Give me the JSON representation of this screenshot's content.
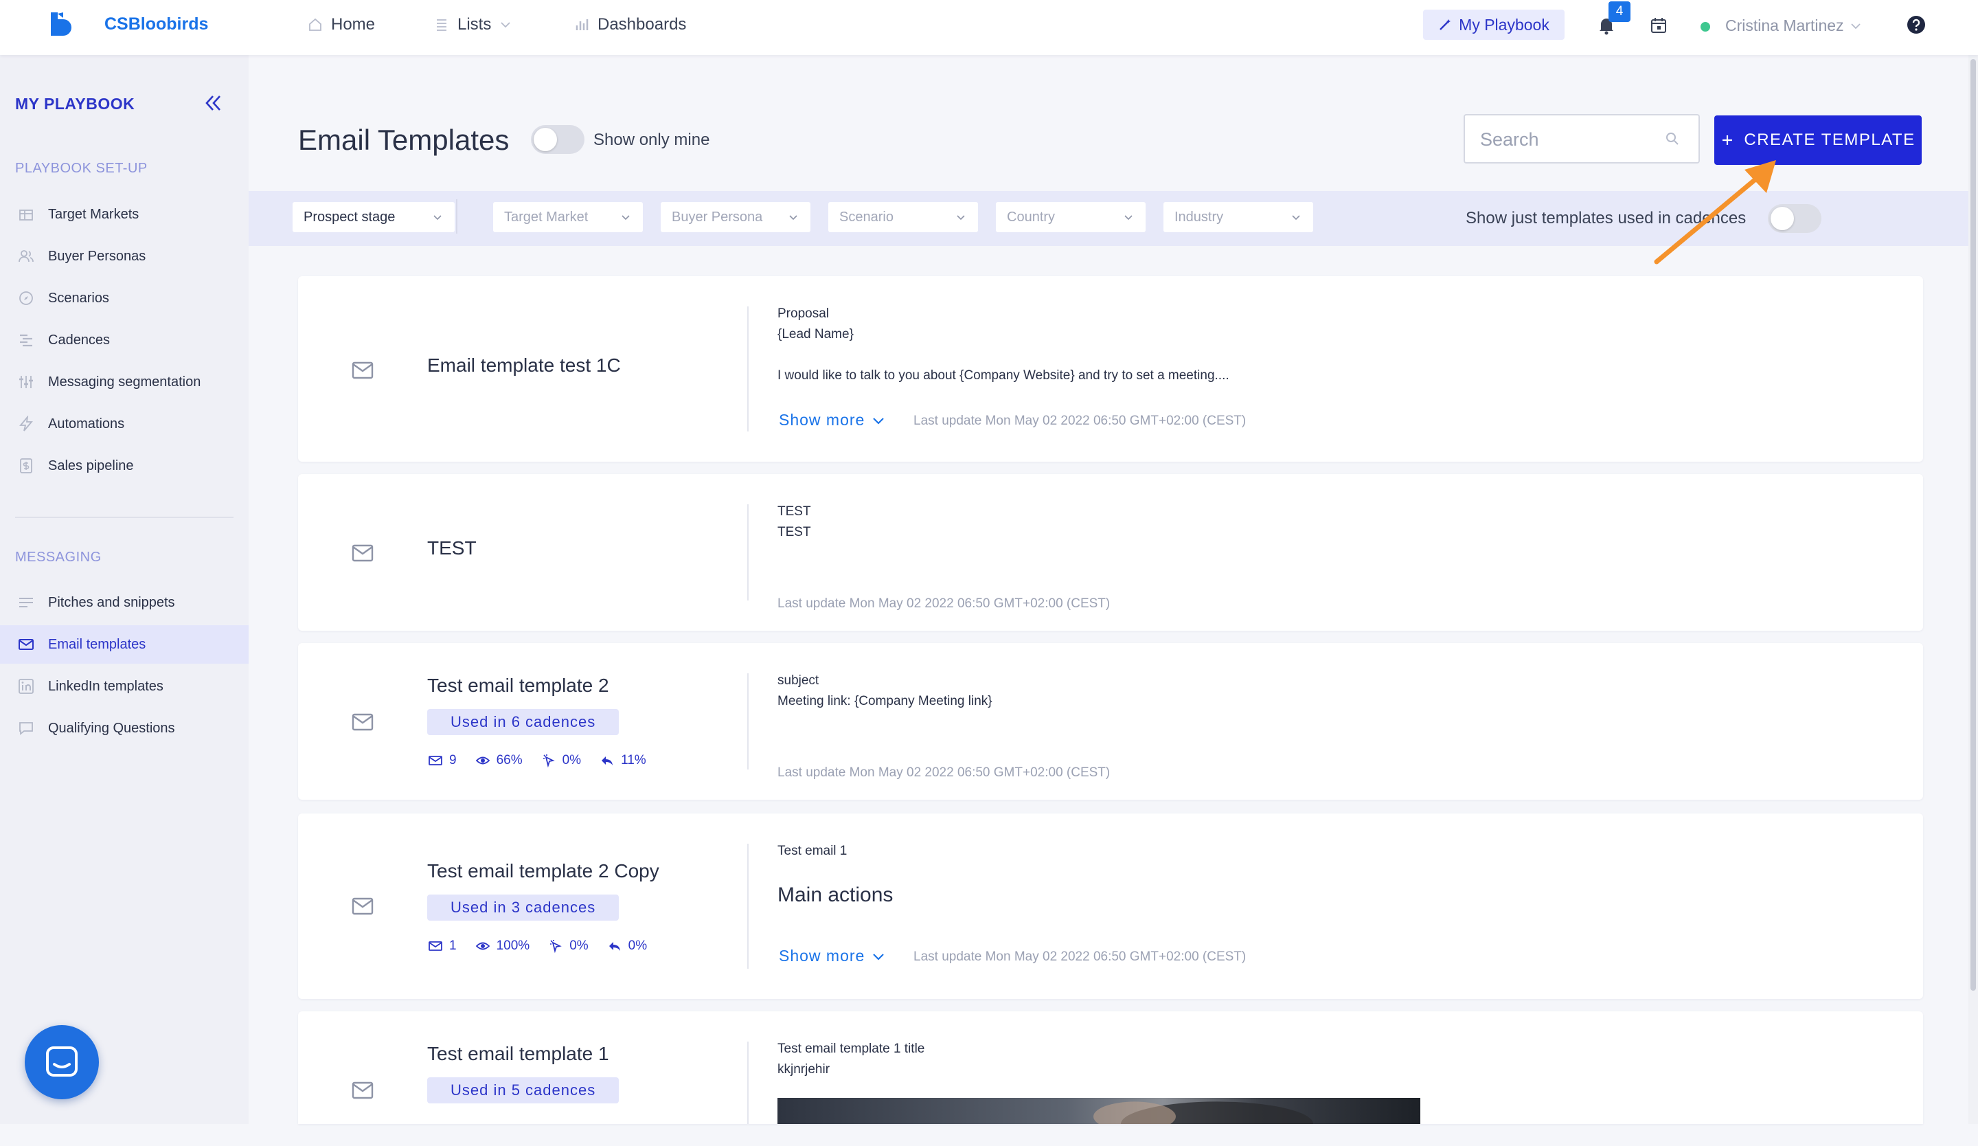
{
  "app": {
    "brand": "CSBloobirds",
    "nav": [
      {
        "label": "Home",
        "icon": "home-icon"
      },
      {
        "label": "Lists",
        "icon": "list-icon"
      },
      {
        "label": "Dashboards",
        "icon": "bar-chart-icon"
      }
    ],
    "playbook_button": "My Playbook",
    "notification_count": "4",
    "user_name": "Cristina Martinez",
    "user_status": "online"
  },
  "sidebar": {
    "title": "MY PLAYBOOK",
    "sections": [
      {
        "label": "PLAYBOOK SET-UP",
        "items": [
          {
            "label": "Target Markets",
            "icon": "target-markets-icon"
          },
          {
            "label": "Buyer Personas",
            "icon": "buyer-personas-icon"
          },
          {
            "label": "Scenarios",
            "icon": "compass-icon"
          },
          {
            "label": "Cadences",
            "icon": "cadences-icon"
          },
          {
            "label": "Messaging segmentation",
            "icon": "sliders-icon"
          },
          {
            "label": "Automations",
            "icon": "bolt-icon"
          },
          {
            "label": "Sales pipeline",
            "icon": "dollar-icon"
          }
        ]
      },
      {
        "label": "MESSAGING",
        "items": [
          {
            "label": "Pitches and snippets",
            "icon": "lines-icon"
          },
          {
            "label": "Email templates",
            "icon": "mail-icon",
            "active": true
          },
          {
            "label": "LinkedIn templates",
            "icon": "linkedin-icon"
          },
          {
            "label": "Qualifying Questions",
            "icon": "chat-icon"
          }
        ]
      }
    ]
  },
  "main": {
    "title": "Email Templates",
    "show_only_mine_label": "Show only mine",
    "search_placeholder": "Search",
    "create_button": "CREATE TEMPLATE",
    "filters": [
      "Prospect stage",
      "Target Market",
      "Buyer Persona",
      "Scenario",
      "Country",
      "Industry"
    ],
    "cadences_toggle_label": "Show just templates used in cadences",
    "show_more": "Show more",
    "templates": [
      {
        "name": "Email template test 1C",
        "lines": [
          "Proposal",
          "{Lead Name}",
          "I would like to talk to you about {Company Website} and try to set a meeting...."
        ],
        "last_update": "Last update Mon May 02 2022 06:50 GMT+02:00 (CEST)"
      },
      {
        "name": "TEST",
        "lines": [
          "TEST",
          "TEST"
        ],
        "last_update": "Last update Mon May 02 2022 06:50 GMT+02:00 (CEST)"
      },
      {
        "name": "Test email template 2",
        "badge": "Used in 6 cadences",
        "stats": {
          "sent": "9",
          "opened": "66%",
          "clicked": "0%",
          "replied": "11%"
        },
        "lines": [
          "subject",
          "Meeting link: {Company Meeting link}"
        ],
        "last_update": "Last update Mon May 02 2022 06:50 GMT+02:00 (CEST)"
      },
      {
        "name": "Test email template 2 Copy",
        "badge": "Used in 3 cadences",
        "stats": {
          "sent": "1",
          "opened": "100%",
          "clicked": "0%",
          "replied": "0%"
        },
        "lines": [
          "Test email 1",
          "Main actions"
        ],
        "last_update": "Last update Mon May 02 2022 06:50 GMT+02:00 (CEST)"
      },
      {
        "name": "Test email template 1",
        "badge": "Used in 5 cadences",
        "lines": [
          "Test email template 1 title",
          "kkjnrjehir"
        ]
      }
    ]
  },
  "colors": {
    "accent": "#2028d8",
    "link": "#1a73e8",
    "annotation_arrow": "#f5922b",
    "sidebar_bg": "#eff0f6"
  }
}
